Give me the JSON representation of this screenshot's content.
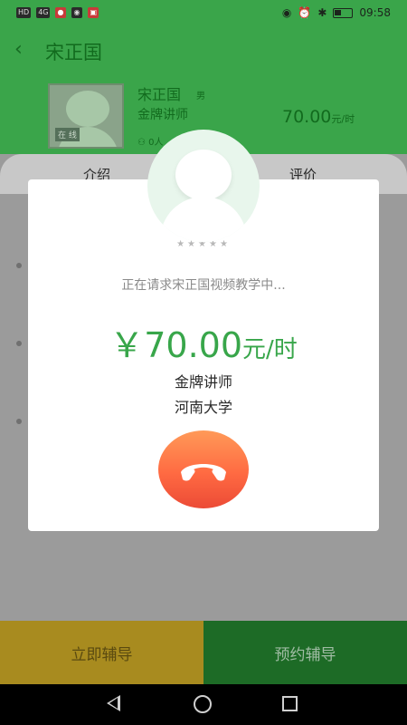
{
  "status": {
    "time": "09:58"
  },
  "header": {
    "title": "宋正国"
  },
  "teacher": {
    "name": "宋正国",
    "gender": "男",
    "level": "金牌讲师",
    "student_count": "0人",
    "price": "70.00",
    "price_unit": "元/时",
    "photo_tag": "在 线"
  },
  "tabs": [
    {
      "label": "介绍"
    },
    {
      "label": "评价"
    }
  ],
  "bottom": {
    "now_label": "立即辅导",
    "book_label": "预约辅导"
  },
  "modal": {
    "stars": "★★★★★",
    "request_text": "正在请求宋正国视频教学中...",
    "currency": "￥",
    "price": "70.00",
    "price_unit": "元/时",
    "level": "金牌讲师",
    "school": "河南大学"
  },
  "colors": {
    "accent": "#38a64a",
    "hangup": "#ff6a42"
  }
}
